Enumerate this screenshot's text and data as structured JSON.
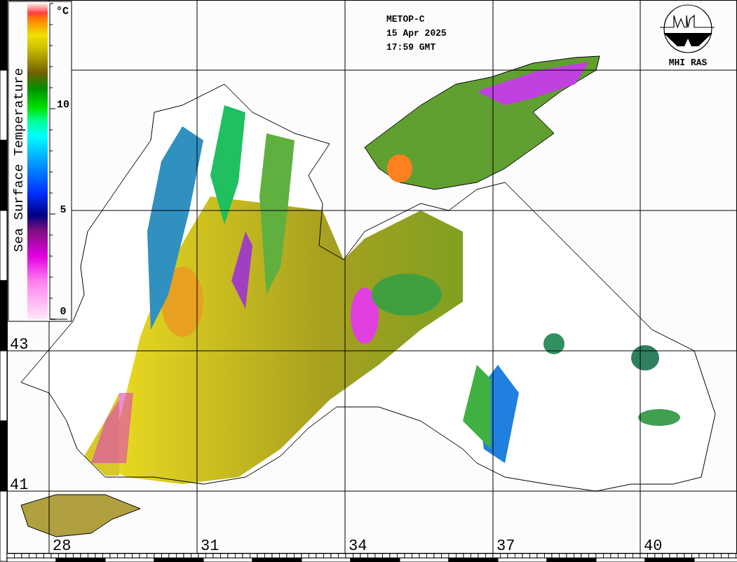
{
  "satellite": "METOP-C",
  "date": "15 Apr 2025",
  "time": "17:59 GMT",
  "logo": {
    "label": "MHI RAS"
  },
  "colorbar": {
    "title": "Sea Surface Temperature",
    "unit": "°C",
    "ticks": [
      "10",
      "5",
      "0"
    ]
  },
  "latitude_labels": [
    "43",
    "41"
  ],
  "longitude_labels": [
    "28",
    "31",
    "34",
    "37",
    "40"
  ]
}
